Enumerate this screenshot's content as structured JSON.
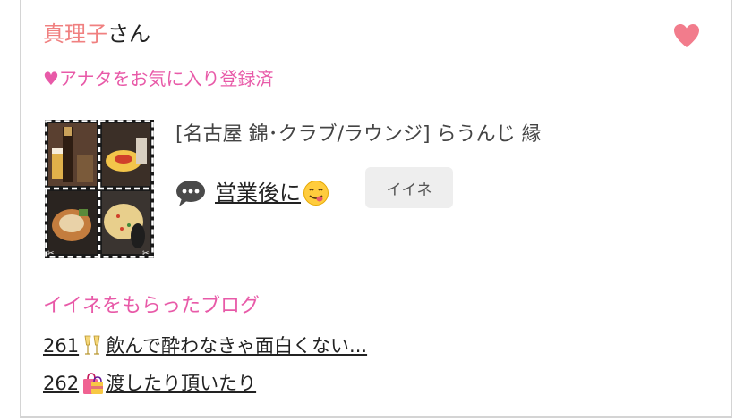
{
  "profile": {
    "name": "真理子",
    "honorific": "さん",
    "favorite_status": "♥アナタをお気に入り登録済"
  },
  "post": {
    "shop": "[名古屋 錦･クラブ/ラウンジ]  らうんじ 縁",
    "title": "営業後に",
    "iine_label": "イイネ"
  },
  "liked_blogs": {
    "heading": "イイネをもらったブログ",
    "items": [
      {
        "number": "261",
        "title": "飲んで酔わなきゃ面白くない..."
      },
      {
        "number": "262",
        "title": "渡したり頂いたり"
      }
    ]
  },
  "colors": {
    "name_pink": "#f08080",
    "accent_pink": "#e85aa8",
    "heart": "#f27c8c"
  },
  "icons": [
    "heart-icon",
    "speech-bubble-icon",
    "yummy-face-emoji-icon",
    "champagne-glasses-icon",
    "shopping-bags-icon"
  ]
}
